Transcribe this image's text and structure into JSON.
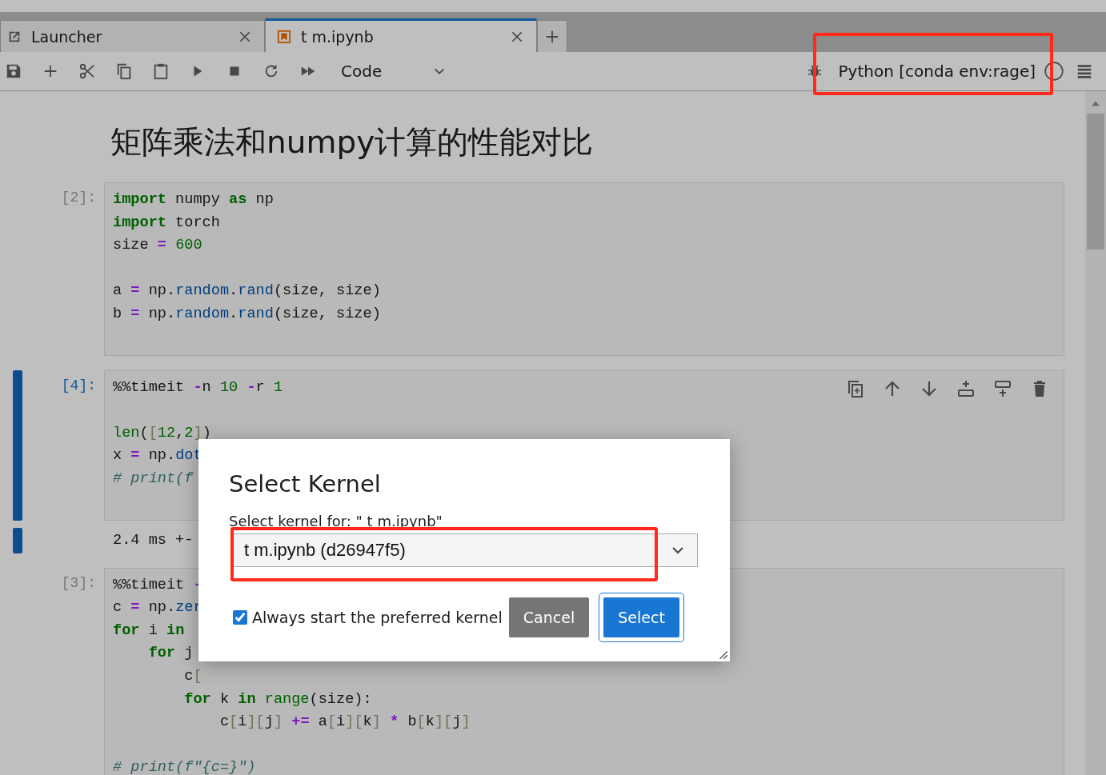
{
  "tabs": [
    {
      "label": "Launcher",
      "selected": false,
      "kind": "launcher"
    },
    {
      "label": "t m.ipynb",
      "selected": true,
      "kind": "notebook"
    }
  ],
  "toolbar": {
    "cell_type": "Code",
    "kernel": "Python [conda env:rage]",
    "kernel_busy": false
  },
  "notebook": {
    "heading": "矩阵乘法和numpy计算的性能对比",
    "cells": [
      {
        "prompt": "[2]:",
        "active": false,
        "lines": [
          {
            "tokens": [
              {
                "kind": "kw",
                "text": "import"
              },
              {
                "kind": "p",
                "text": " numpy "
              },
              {
                "kind": "kw",
                "text": "as"
              },
              {
                "kind": "p",
                "text": " np"
              }
            ]
          },
          {
            "tokens": [
              {
                "kind": "kw",
                "text": "import"
              },
              {
                "kind": "p",
                "text": " torch"
              }
            ]
          },
          {
            "tokens": [
              {
                "kind": "p",
                "text": "size "
              },
              {
                "kind": "op",
                "text": "="
              },
              {
                "kind": "num",
                "text": " 600"
              }
            ]
          },
          {
            "blank_before": true,
            "tokens": [
              {
                "kind": "p",
                "text": "a "
              },
              {
                "kind": "op",
                "text": "="
              },
              {
                "kind": "p",
                "text": " np."
              },
              {
                "kind": "fn",
                "text": "random"
              },
              {
                "kind": "p",
                "text": "."
              },
              {
                "kind": "fn",
                "text": "rand"
              },
              {
                "kind": "p",
                "text": "(size, size)"
              }
            ]
          },
          {
            "tokens": [
              {
                "kind": "p",
                "text": "b "
              },
              {
                "kind": "op",
                "text": "="
              },
              {
                "kind": "p",
                "text": " np."
              },
              {
                "kind": "fn",
                "text": "random"
              },
              {
                "kind": "p",
                "text": "."
              },
              {
                "kind": "fn",
                "text": "rand"
              },
              {
                "kind": "p",
                "text": "(size, size)"
              }
            ]
          }
        ]
      },
      {
        "prompt": "[4]:",
        "active": true,
        "lines": [
          {
            "tokens": [
              {
                "kind": "p",
                "text": "%%timeit "
              },
              {
                "kind": "op",
                "text": "-"
              },
              {
                "kind": "p",
                "text": "n "
              },
              {
                "kind": "num",
                "text": "10"
              },
              {
                "kind": "op",
                "text": " -"
              },
              {
                "kind": "p",
                "text": "r "
              },
              {
                "kind": "num",
                "text": "1"
              }
            ]
          },
          {
            "blank_before": true,
            "tokens": [
              {
                "kind": "bi",
                "text": "len"
              },
              {
                "kind": "p",
                "text": "("
              },
              {
                "kind": "br",
                "text": "["
              },
              {
                "kind": "num",
                "text": "12"
              },
              {
                "kind": "p",
                "text": ","
              },
              {
                "kind": "num",
                "text": "2"
              },
              {
                "kind": "br",
                "text": "]"
              },
              {
                "kind": "p",
                "text": ")"
              }
            ]
          },
          {
            "tokens": [
              {
                "kind": "p",
                "text": "x "
              },
              {
                "kind": "op",
                "text": "="
              },
              {
                "kind": "p",
                "text": " np."
              },
              {
                "kind": "fn",
                "text": "dot"
              }
            ]
          },
          {
            "tokens": [
              {
                "kind": "cm",
                "text": "# print(f"
              }
            ]
          }
        ],
        "output": "2.4 ms +-"
      },
      {
        "prompt": "[3]:",
        "active": false,
        "lines": [
          {
            "tokens": [
              {
                "kind": "p",
                "text": "%%timeit "
              },
              {
                "kind": "op",
                "text": "-"
              }
            ]
          },
          {
            "tokens": [
              {
                "kind": "p",
                "text": "c "
              },
              {
                "kind": "op",
                "text": "="
              },
              {
                "kind": "p",
                "text": " np."
              },
              {
                "kind": "fn",
                "text": "zer"
              }
            ]
          },
          {
            "tokens": [
              {
                "kind": "kw",
                "text": "for"
              },
              {
                "kind": "p",
                "text": " i "
              },
              {
                "kind": "kw",
                "text": "in"
              }
            ]
          },
          {
            "tokens": [
              {
                "kind": "kw",
                "text": "    for"
              },
              {
                "kind": "p",
                "text": " j"
              }
            ]
          },
          {
            "tokens": [
              {
                "kind": "p",
                "text": "        c"
              },
              {
                "kind": "br",
                "text": "["
              }
            ]
          },
          {
            "tokens": [
              {
                "kind": "kw",
                "text": "        for"
              },
              {
                "kind": "p",
                "text": " k "
              },
              {
                "kind": "kw",
                "text": "in"
              },
              {
                "kind": "bi",
                "text": " range"
              },
              {
                "kind": "p",
                "text": "(size):"
              }
            ]
          },
          {
            "tokens": [
              {
                "kind": "p",
                "text": "            c"
              },
              {
                "kind": "br",
                "text": "["
              },
              {
                "kind": "p",
                "text": "i"
              },
              {
                "kind": "br",
                "text": "]["
              },
              {
                "kind": "p",
                "text": "j"
              },
              {
                "kind": "br",
                "text": "]"
              },
              {
                "kind": "op",
                "text": " +="
              },
              {
                "kind": "p",
                "text": " a"
              },
              {
                "kind": "br",
                "text": "["
              },
              {
                "kind": "p",
                "text": "i"
              },
              {
                "kind": "br",
                "text": "]["
              },
              {
                "kind": "p",
                "text": "k"
              },
              {
                "kind": "br",
                "text": "]"
              },
              {
                "kind": "op",
                "text": " *"
              },
              {
                "kind": "p",
                "text": " b"
              },
              {
                "kind": "br",
                "text": "["
              },
              {
                "kind": "p",
                "text": "k"
              },
              {
                "kind": "br",
                "text": "]["
              },
              {
                "kind": "p",
                "text": "j"
              },
              {
                "kind": "br",
                "text": "]"
              }
            ]
          },
          {
            "blank_before": true,
            "tokens": [
              {
                "kind": "cm",
                "text": "# print(f\"{c=}\")"
              }
            ]
          }
        ]
      }
    ]
  },
  "dialog": {
    "title": "Select Kernel",
    "label": "Select kernel for: \" t m.ipynb\"",
    "kernel_option": "t m.ipynb (d26947f5)",
    "always_start": {
      "label": "Always start the preferred kernel",
      "checked": true
    },
    "buttons": [
      {
        "label": "Cancel",
        "kind": "cancel"
      },
      {
        "label": "Select",
        "kind": "accept"
      }
    ]
  }
}
